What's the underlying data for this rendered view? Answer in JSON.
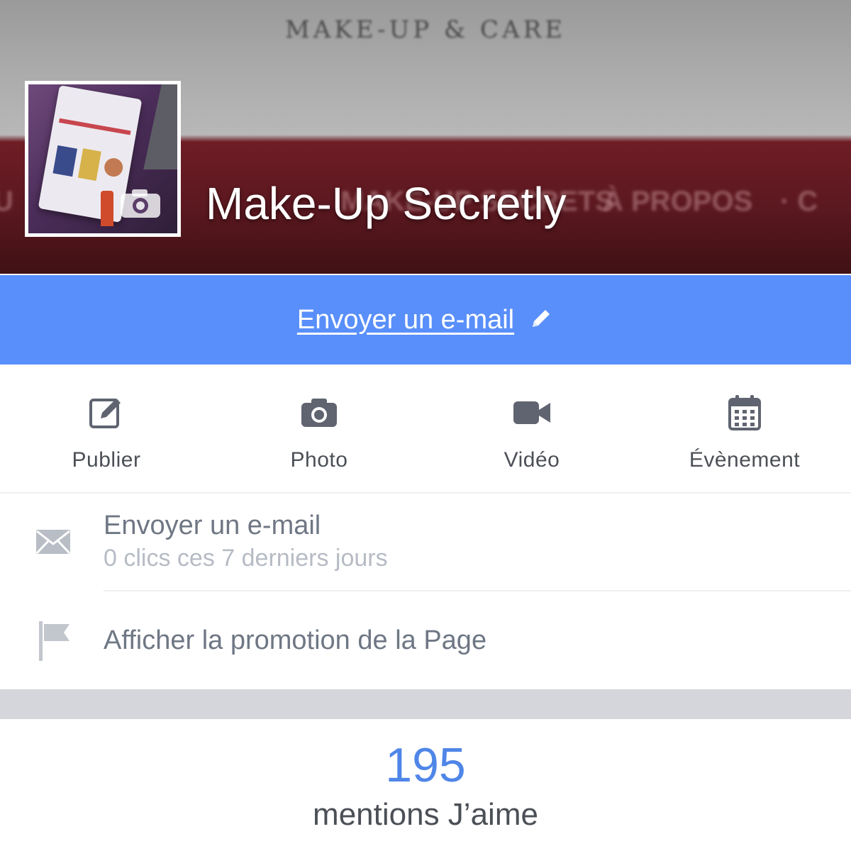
{
  "cover": {
    "banner_text": "MAKE-UP & CARE",
    "nav_left": "U",
    "nav_middle": "MAKE-UP SECRETS",
    "nav_right": "À PROPOS",
    "nav_far_right": "· C"
  },
  "profile": {
    "page_name": "Make-Up Secretly"
  },
  "cta": {
    "label": "Envoyer un e-mail",
    "edit_icon": "pencil-icon"
  },
  "actions": [
    {
      "label": "Publier",
      "icon": "compose-icon"
    },
    {
      "label": "Photo",
      "icon": "camera-icon"
    },
    {
      "label": "Vidéo",
      "icon": "video-icon"
    },
    {
      "label": "Évènement",
      "icon": "calendar-icon"
    }
  ],
  "rows": {
    "email": {
      "title": "Envoyer un e-mail",
      "subtitle": "0 clics ces 7 derniers jours",
      "icon": "envelope-icon"
    },
    "promotion": {
      "title": "Afficher la promotion de la Page",
      "icon": "flag-icon"
    }
  },
  "likes": {
    "count": "195",
    "label": "mentions J’aime"
  },
  "colors": {
    "cta_blue": "#598ffa",
    "likes_blue": "#4f86e8",
    "text_dark": "#4b4f56",
    "text_gray": "#6f7784",
    "text_light": "#b6bbc4"
  }
}
